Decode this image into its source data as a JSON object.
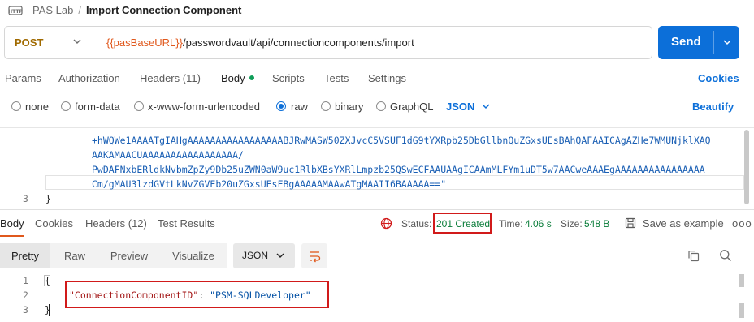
{
  "breadcrumb": {
    "icon": "http-icon",
    "collection": "PAS Lab",
    "separator": "/",
    "title": "Import Connection Component"
  },
  "request": {
    "method": "POST",
    "url_variable": "{{pasBaseURL}}",
    "url_path": "/passwordvault/api/connectioncomponents/import",
    "send_label": "Send"
  },
  "tabs": {
    "params": "Params",
    "authorization": "Authorization",
    "headers": "Headers (11)",
    "body": "Body",
    "scripts": "Scripts",
    "tests": "Tests",
    "settings": "Settings",
    "cookies": "Cookies"
  },
  "body_types": {
    "none": "none",
    "form_data": "form-data",
    "urlencoded": "x-www-form-urlencoded",
    "raw": "raw",
    "binary": "binary",
    "graphql": "GraphQL",
    "format": "JSON",
    "beautify": "Beautify",
    "selected": "raw"
  },
  "request_editor": {
    "lines": [
      "+hWQWe1AAAATgIAHgAAAAAAAAAAAAAAAAABJRwMASW50ZXJvcC5VSUF1dG9tYXRpb25DbGllbnQuZGxsUEsBAhQAFAAICAgAZHe7WMUNjklXAQ",
      "AAKAMAACUAAAAAAAAAAAAAAAAA/",
      "PwDAFNxbERldkNvbmZpZy9Db25uZWN0aW9uc1RlbXBsYXRlLmpzb25QSwECFAAUAAgICAAmMLFYm1uDT5w7AACweAAAEgAAAAAAAAAAAAAAAA",
      "Cm/gMAU3lzdGVtLkNvZGVEb20uZGxsUEsFBgAAAAAMAAwATgMAAII6BAAAAA==\""
    ],
    "last_line_number": "3",
    "closing_brace": "}"
  },
  "response": {
    "tabs": {
      "body": "Body",
      "cookies": "Cookies",
      "headers": "Headers (12)",
      "test_results": "Test Results"
    },
    "status_label": "Status:",
    "status_value": "201 Created",
    "time_label": "Time:",
    "time_value": "4.06 s",
    "size_label": "Size:",
    "size_value": "548 B",
    "save_label": "Save as example",
    "more": "ooo",
    "views": {
      "pretty": "Pretty",
      "raw": "Raw",
      "preview": "Preview",
      "visualize": "Visualize"
    },
    "format": "JSON",
    "body_lines": {
      "line_numbers": [
        "1",
        "2",
        "3"
      ],
      "open_brace": "{",
      "key": "\"ConnectionComponentID\"",
      "colon": ": ",
      "value": "\"PSM-SQLDeveloper\"",
      "close_brace": "}"
    }
  },
  "colors": {
    "accent": "#0c6fd9",
    "method": "#a06a00",
    "variable": "#e0581c",
    "status_ok": "#0a7d3a",
    "highlight": "#d11a1a"
  }
}
